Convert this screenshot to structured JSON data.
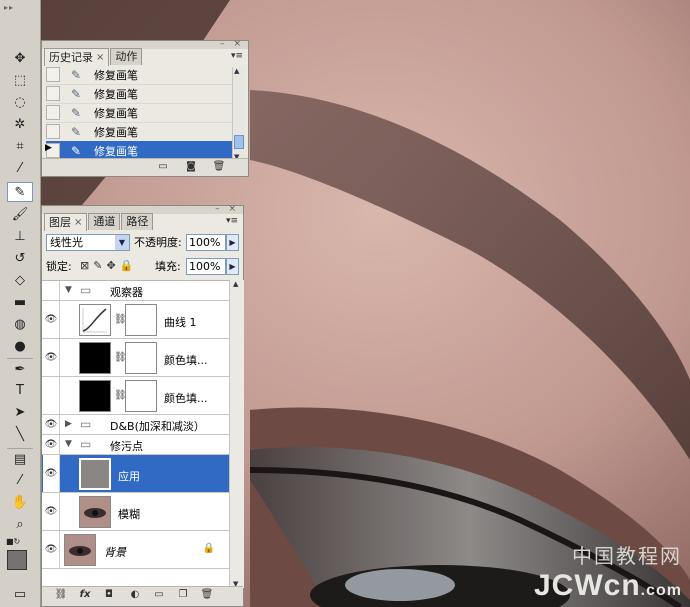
{
  "history_panel": {
    "tabs": [
      {
        "label": "历史记录",
        "active": true
      },
      {
        "label": "动作",
        "active": false
      }
    ],
    "items": [
      {
        "label": "修复画笔",
        "icon": "healing-brush-icon",
        "selected": false
      },
      {
        "label": "修复画笔",
        "icon": "healing-brush-icon",
        "selected": false
      },
      {
        "label": "修复画笔",
        "icon": "healing-brush-icon",
        "selected": false
      },
      {
        "label": "修复画笔",
        "icon": "healing-brush-icon",
        "selected": false
      },
      {
        "label": "修复画笔",
        "icon": "healing-brush-icon",
        "selected": true
      }
    ],
    "footer_icons": [
      "new-document-from-state-icon",
      "camera-snapshot-icon",
      "trash-icon"
    ]
  },
  "layers_panel": {
    "tabs": [
      {
        "label": "图层",
        "active": true
      },
      {
        "label": "通道",
        "active": false
      },
      {
        "label": "路径",
        "active": false
      }
    ],
    "blend_mode": "线性光",
    "opacity_label": "不透明度:",
    "opacity_value": "100%",
    "lock_label": "锁定:",
    "fill_label": "填充:",
    "fill_value": "100%",
    "layers": [
      {
        "name": "观察器",
        "kind": "group",
        "visible": false,
        "expanded": true,
        "indent": 0
      },
      {
        "name": "曲线 1",
        "kind": "curves-adjustment",
        "visible": true,
        "indent": 1
      },
      {
        "name": "颜色填...",
        "kind": "fill",
        "visible": true,
        "indent": 1
      },
      {
        "name": "颜色填...",
        "kind": "fill",
        "visible": false,
        "indent": 1
      },
      {
        "name": "D&B(加深和减淡）",
        "kind": "group",
        "visible": true,
        "expanded": false,
        "indent": 0
      },
      {
        "name": "修污点",
        "kind": "group",
        "visible": true,
        "expanded": true,
        "indent": 0
      },
      {
        "name": "应用",
        "kind": "pixel",
        "visible": true,
        "selected": true,
        "indent": 1
      },
      {
        "name": "模糊",
        "kind": "pixel",
        "visible": true,
        "indent": 1
      },
      {
        "name": "背景",
        "kind": "background",
        "visible": true,
        "locked": true,
        "indent": 0
      }
    ],
    "footer_icons": [
      "link-icon",
      "fx-icon",
      "add-mask-icon",
      "adjustment-layer-icon",
      "new-group-icon",
      "new-layer-icon",
      "trash-icon"
    ]
  },
  "watermark": {
    "line1": "中国教程网",
    "line2": "JCWcn",
    "line2_suffix": ".com"
  },
  "colors": {
    "selection": "#316ac5",
    "panel_bg": "#ece9e2"
  }
}
